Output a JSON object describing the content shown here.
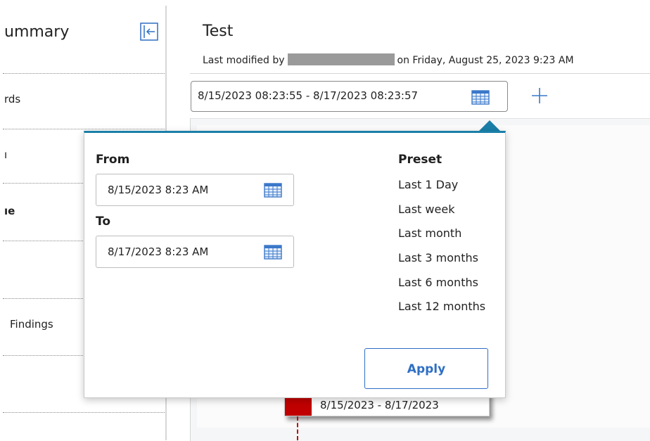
{
  "sidebar": {
    "title": "ummary",
    "items": [
      {
        "label": "rds"
      },
      {
        "label": "ı"
      },
      {
        "label": "ıe"
      },
      {
        "label": ""
      },
      {
        "label": "Findings"
      },
      {
        "label": ""
      }
    ]
  },
  "header": {
    "title": "Test",
    "modified_prefix": "Last modified by",
    "modified_suffix": "on Friday, August 25, 2023 9:23 AM"
  },
  "range_field": {
    "value": "8/15/2023 08:23:55  -  8/17/2023 08:23:57"
  },
  "timeline": {
    "event_label": "8/15/2023 - 8/17/2023"
  },
  "popover": {
    "from_label": "From",
    "from_value": "8/15/2023 8:23 AM",
    "to_label": "To",
    "to_value": "8/17/2023 8:23 AM",
    "preset_label": "Preset",
    "presets": [
      "Last 1 Day",
      "Last week",
      "Last month",
      "Last 3 months",
      "Last 6 months",
      "Last 12 months"
    ],
    "apply_label": "Apply"
  },
  "colors": {
    "accent": "#2f6fc4",
    "popover_border": "#1a7fa8",
    "event_marker": "#c00000"
  },
  "icons": {
    "collapse": "collapse-left-icon",
    "calendar": "calendar-icon",
    "add": "plus-icon"
  }
}
